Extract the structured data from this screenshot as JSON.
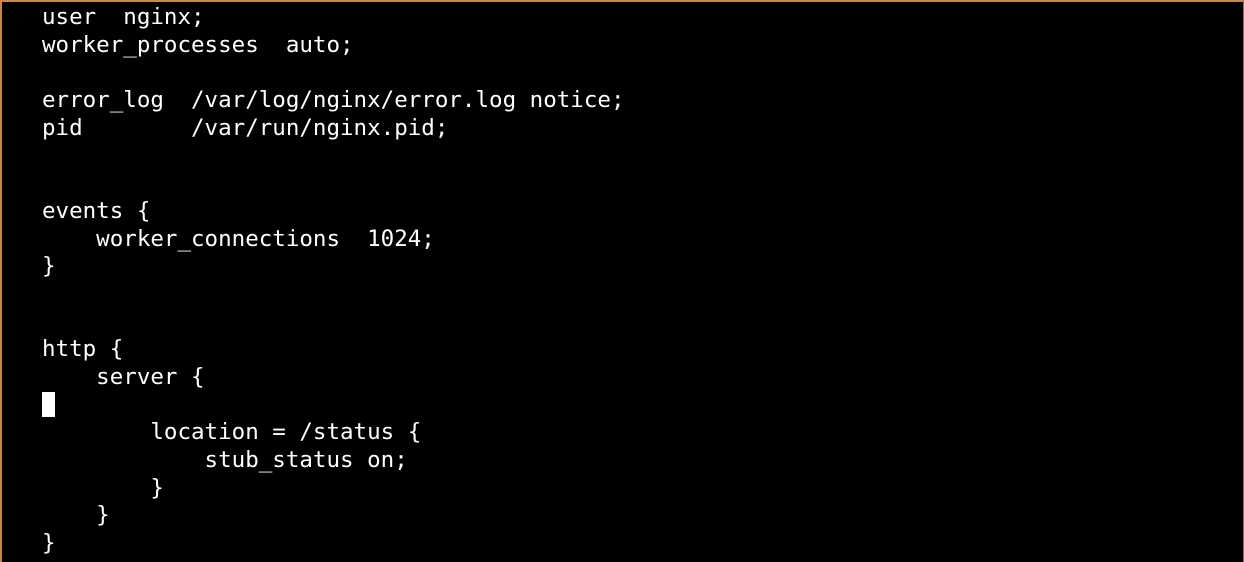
{
  "window": {
    "accent": "#c98a3c",
    "background": "#000000",
    "foreground": "#ffffff"
  },
  "editor": {
    "lines": [
      "user  nginx;",
      "worker_processes  auto;",
      "",
      "error_log  /var/log/nginx/error.log notice;",
      "pid        /var/run/nginx.pid;",
      "",
      "",
      "events {",
      "    worker_connections  1024;",
      "}",
      "",
      "",
      "http {",
      "    server {",
      "",
      "        location = /status {",
      "            stub_status on;",
      "        }",
      "    }",
      "}"
    ],
    "cursor_line": 15
  }
}
